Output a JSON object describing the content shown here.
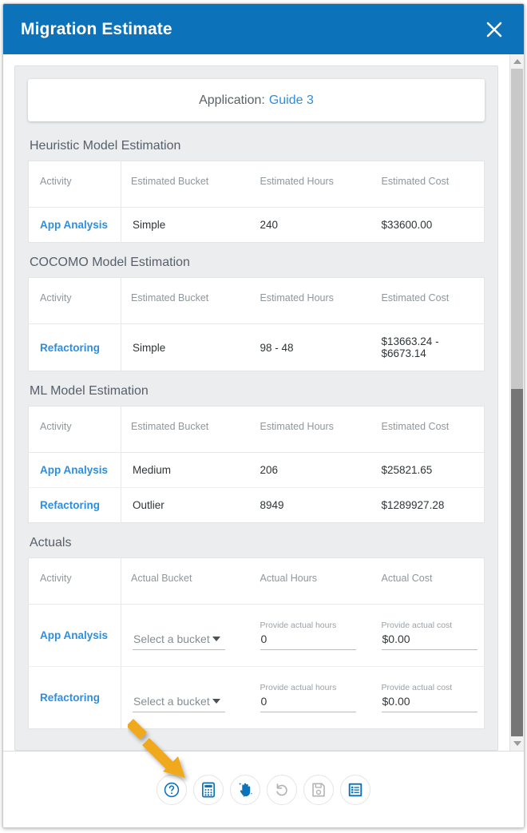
{
  "dialog": {
    "title": "Migration Estimate",
    "close_icon": "close-icon",
    "accent_color": "#0c72b9",
    "link_color": "#2b8ee0"
  },
  "banner": {
    "label": "Application:",
    "value": "Guide 3"
  },
  "sections": [
    {
      "title": "Heuristic Model Estimation",
      "columns": [
        "Activity",
        "Estimated Bucket",
        "Estimated Hours",
        "Estimated Cost"
      ],
      "rows": [
        {
          "activity": "App Analysis",
          "bucket": "Simple",
          "hours": "240",
          "cost": "$33600.00"
        }
      ]
    },
    {
      "title": "COCOMO Model Estimation",
      "columns": [
        "Activity",
        "Estimated Bucket",
        "Estimated Hours",
        "Estimated Cost"
      ],
      "rows": [
        {
          "activity": "Refactoring",
          "bucket": "Simple",
          "hours": "98 - 48",
          "cost": "$13663.24 - $6673.14"
        }
      ]
    },
    {
      "title": "ML Model Estimation",
      "columns": [
        "Activity",
        "Estimated Bucket",
        "Estimated Hours",
        "Estimated Cost"
      ],
      "rows": [
        {
          "activity": "App Analysis",
          "bucket": "Medium",
          "hours": "206",
          "cost": "$25821.65"
        },
        {
          "activity": "Refactoring",
          "bucket": "Outlier",
          "hours": "8949",
          "cost": "$1289927.28"
        }
      ]
    }
  ],
  "actuals": {
    "title": "Actuals",
    "columns": [
      "Activity",
      "Actual Bucket",
      "Actual Hours",
      "Actual Cost"
    ],
    "rows": [
      {
        "activity": "App Analysis",
        "bucket_value": "Select a bucket",
        "hours_label": "Provide actual hours",
        "hours_value": "0",
        "cost_label": "Provide actual cost",
        "cost_value": "$0.00"
      },
      {
        "activity": "Refactoring",
        "bucket_value": "Select a bucket",
        "hours_label": "Provide actual hours",
        "hours_value": "0",
        "cost_label": "Provide actual cost",
        "cost_value": "$0.00"
      }
    ]
  },
  "toolbar": {
    "buttons": [
      {
        "name": "help-icon",
        "label": "Help",
        "state": "enabled"
      },
      {
        "name": "calculator-icon",
        "label": "Calculate",
        "state": "enabled"
      },
      {
        "name": "magic-hand-icon",
        "label": "Auto Fill",
        "state": "enabled"
      },
      {
        "name": "undo-icon",
        "label": "Undo",
        "state": "disabled"
      },
      {
        "name": "save-icon",
        "label": "Save",
        "state": "disabled"
      },
      {
        "name": "details-icon",
        "label": "Details",
        "state": "active"
      }
    ]
  },
  "scrollbar": {
    "up_icon": "chevron-up-icon",
    "down_icon": "chevron-down-icon",
    "thumb_position_percent": "48"
  },
  "annotation": {
    "arrow_color": "#f0a81e",
    "points_to": "calculator-icon"
  }
}
